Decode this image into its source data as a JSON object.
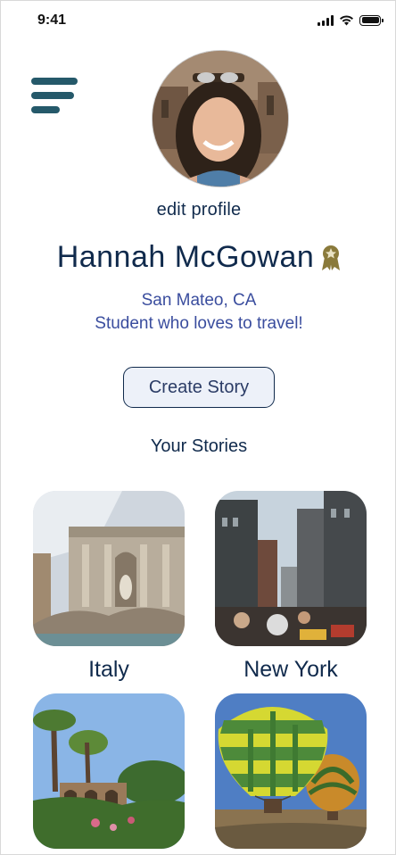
{
  "status_bar": {
    "time": "9:41",
    "icons": [
      "signal-icon",
      "wifi-icon",
      "battery-icon"
    ]
  },
  "header": {
    "menu_icon": "hamburger-menu-icon"
  },
  "profile": {
    "edit_label": "edit profile",
    "name": "Hannah McGowan",
    "badge_icon": "award-badge-icon",
    "location": "San Mateo, CA",
    "bio": "Student who loves to travel!"
  },
  "actions": {
    "create_story_label": "Create Story"
  },
  "stories": {
    "heading": "Your Stories",
    "items": [
      {
        "label": "Italy"
      },
      {
        "label": "New York"
      },
      {
        "label": ""
      },
      {
        "label": ""
      }
    ]
  },
  "colors": {
    "primary_text": "#102a4c",
    "secondary_text": "#3a4d9e",
    "menu_icon": "#25596a",
    "badge": "#8a7a3b",
    "button_bg": "#edf1f9"
  }
}
